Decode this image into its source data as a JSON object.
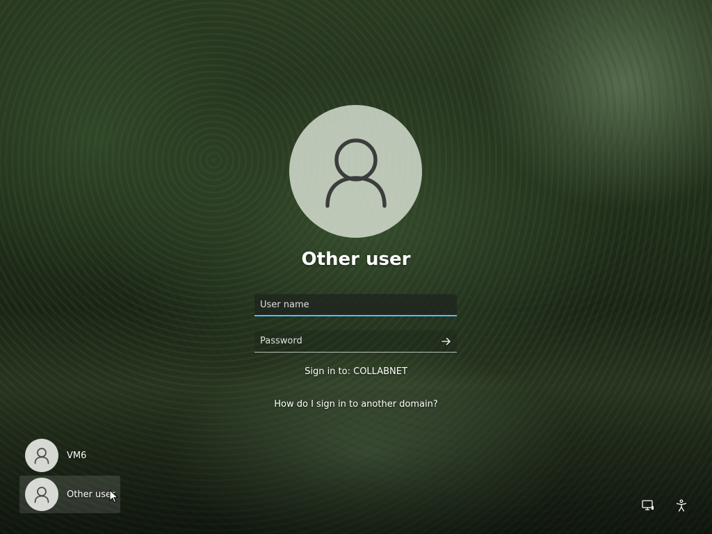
{
  "login": {
    "title": "Other user",
    "username_placeholder": "User name",
    "password_placeholder": "Password",
    "signin_to": "Sign in to: COLLABNET",
    "domain_help_link": "How do I sign in to another domain?"
  },
  "users": [
    {
      "name": "VM6",
      "selected": false
    },
    {
      "name": "Other user",
      "selected": true
    }
  ],
  "corner_icons": {
    "network": "network-icon",
    "accessibility": "accessibility-icon"
  },
  "colors": {
    "accent": "#4cc2ff",
    "text": "#ffffff"
  }
}
